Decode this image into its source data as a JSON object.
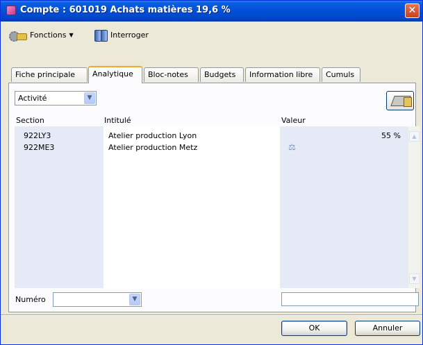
{
  "window": {
    "title": "Compte : 601019 Achats matières 19,6 %",
    "close_symbol": "✕"
  },
  "toolbar": {
    "fonctions_label": "Fonctions",
    "fonctions_caret": "▼",
    "interroger_label": "Interroger"
  },
  "tabs": [
    {
      "label": "Fiche principale",
      "active": false
    },
    {
      "label": "Analytique",
      "active": true
    },
    {
      "label": "Bloc-notes",
      "active": false
    },
    {
      "label": "Budgets",
      "active": false
    },
    {
      "label": "Information libre",
      "active": false
    },
    {
      "label": "Cumuls",
      "active": false
    }
  ],
  "analytique": {
    "axis_select": {
      "value": "Activité",
      "arrow": "▼"
    },
    "columns": {
      "section": "Section",
      "intitule": "Intitulé",
      "valeur": "Valeur"
    },
    "rows": [
      {
        "section": "922LY3",
        "intitule": "Atelier production Lyon",
        "valeur": "55 %",
        "icon": ""
      },
      {
        "section": "922ME3",
        "intitule": "Atelier production Metz",
        "valeur": "",
        "icon": "scale-icon"
      }
    ],
    "scroll_up": "▲",
    "scroll_down": "▼",
    "numero_label": "Numéro",
    "numero_select": {
      "value": "",
      "arrow": "▼"
    },
    "valeur_input": ""
  },
  "icons": {
    "scale_glyph": "⚖"
  },
  "buttons": {
    "ok": "OK",
    "cancel": "Annuler"
  },
  "colors": {
    "title_bar": "#0050D8",
    "active_tab_accent": "#F2A731",
    "list_shade": "#E6EAF6",
    "close_button": "#C5441E"
  }
}
